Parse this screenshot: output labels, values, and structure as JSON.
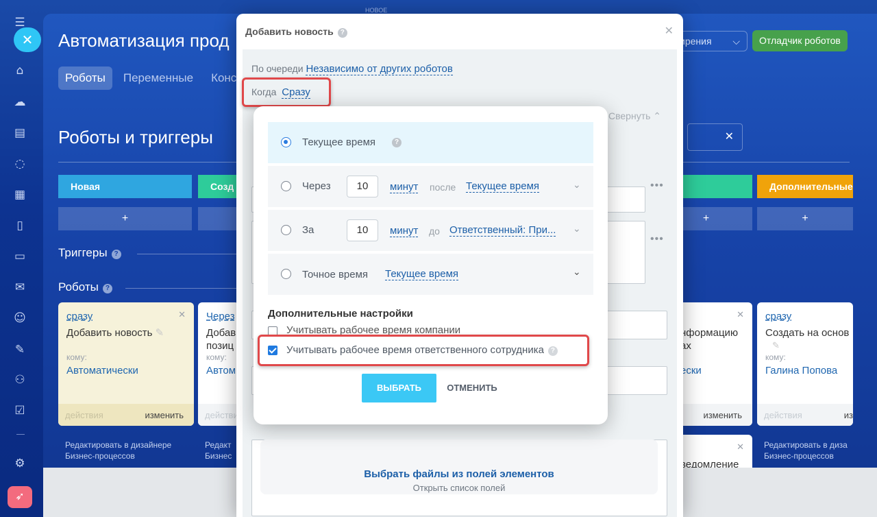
{
  "rail": {
    "icons": [
      "menu-icon",
      "home-icon",
      "feed-icon",
      "tasks-icon",
      "chat-icon",
      "calendar-icon",
      "docs-icon",
      "crm-icon",
      "mail-icon",
      "contacts-icon",
      "sign-icon",
      "robot-icon",
      "checklist-icon",
      "settings-icon",
      "rocket-icon"
    ]
  },
  "bg": {
    "top_label": "НОВОЕ",
    "title": "Автоматизация прод",
    "tabs": [
      "Роботы",
      "Переменные",
      "Конст"
    ],
    "extension_btn": "ирения",
    "debugger_btn": "Отладчик роботов",
    "section_title": "Роботы и триггеры",
    "stages": [
      {
        "label": "Новая",
        "color": "#2fa6e0"
      },
      {
        "label": "Созд",
        "color": "#2ecc9a"
      },
      {
        "label": "",
        "color": "#2ecc9a"
      },
      {
        "label": "Дополнительные",
        "color": "#f0a30a"
      }
    ],
    "plus": "+",
    "triggers_label": "Триггеры",
    "robots_label": "Роботы",
    "cards": [
      {
        "when": "сразу",
        "name": "Добавить новость",
        "to_label": "кому:",
        "to": "Автоматически",
        "actions": "действия",
        "edit": "изменить"
      },
      {
        "when": "Через",
        "name": "Добав позиц",
        "to_label": "кому:",
        "to": "Автом",
        "actions": "действия",
        "edit": ""
      },
      {
        "when": "",
        "name": "нформацию ах",
        "to_label": "",
        "to": "ески",
        "actions": "",
        "edit": "изменить"
      },
      {
        "when": "сразу",
        "name": "Создать на основ",
        "to_label": "кому:",
        "to": "Галина Попова",
        "actions": "действия",
        "edit": "из"
      }
    ],
    "bp_links": [
      "Редактировать в дизайнере Бизнес-процессов",
      "Редакт Бизнес",
      "Редактировать в диза Бизнес-процессов"
    ],
    "notify_text": "ведомление"
  },
  "dialog": {
    "title": "Добавить новость",
    "queue_label": "По очереди",
    "queue_value": "Независимо от других роботов",
    "when_label": "Когда",
    "when_value": "Сразу",
    "collapse": "Свернуть",
    "files_title": "Выбрать файлы из полей элементов",
    "files_sub": "Открыть список полей"
  },
  "popup": {
    "opt1": {
      "label": "Текущее время"
    },
    "opt2": {
      "label": "Через",
      "num": "10",
      "unit": "минут",
      "rel": "после",
      "base": "Текущее время"
    },
    "opt3": {
      "label": "За",
      "num": "10",
      "unit": "минут",
      "rel": "до",
      "base": "Ответственный: При..."
    },
    "opt4": {
      "label": "Точное время",
      "base": "Текущее время"
    },
    "advanced": "Дополнительные настройки",
    "cb1": "Учитывать рабочее время компании",
    "cb2": "Учитывать рабочее время ответственного сотрудника",
    "ok": "ВЫБРАТЬ",
    "cancel": "ОТМЕНИТЬ"
  }
}
